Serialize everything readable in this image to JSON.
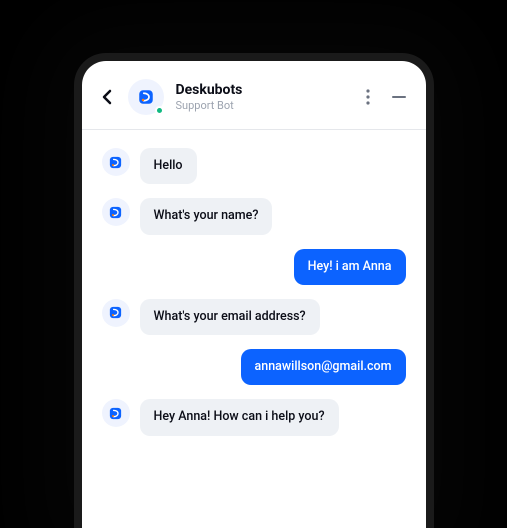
{
  "header": {
    "bot_name": "Deskubots",
    "bot_subtitle": "Support Bot"
  },
  "messages": [
    {
      "sender": "bot",
      "text": "Hello"
    },
    {
      "sender": "bot",
      "text": "What's your name?"
    },
    {
      "sender": "user",
      "text": "Hey! i am Anna"
    },
    {
      "sender": "bot",
      "text": "What's your email address?"
    },
    {
      "sender": "user",
      "text": "annawillson@gmail.com"
    },
    {
      "sender": "bot",
      "text": "Hey Anna! How can i help you?"
    }
  ],
  "colors": {
    "primary": "#0c63ff",
    "bot_bubble": "#eef1f5",
    "avatar_bg": "#eff3fe"
  }
}
